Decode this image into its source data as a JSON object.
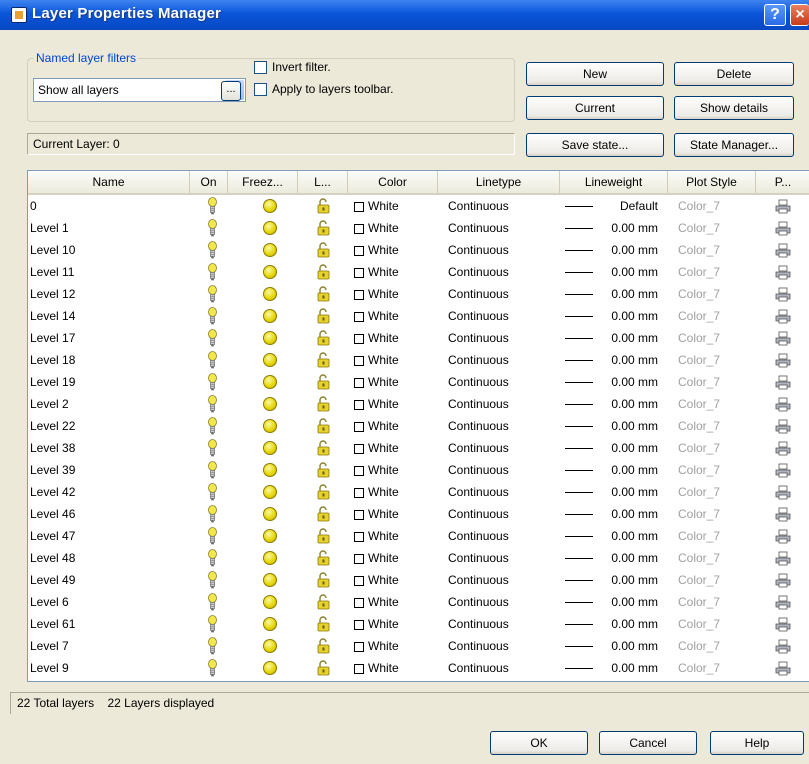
{
  "window": {
    "title": "Layer Properties Manager",
    "help_label": "?",
    "close_label": "×",
    "app_icon": "layer-properties-icon"
  },
  "filters": {
    "group_label": "Named layer filters",
    "selected": "Show all layers",
    "ellipsis_label": "...",
    "invert_label": "Invert filter.",
    "invert_checked": false,
    "apply_label": "Apply to layers toolbar.",
    "apply_checked": false
  },
  "buttons": {
    "new": "New",
    "delete": "Delete",
    "current": "Current",
    "show_details": "Show details",
    "save_state": "Save state...",
    "state_manager": "State Manager...",
    "ok": "OK",
    "cancel": "Cancel",
    "help": "Help"
  },
  "current_layer": "Current Layer: 0",
  "columns": [
    "Name",
    "On",
    "Freez...",
    "L...",
    "Color",
    "Linetype",
    "Lineweight",
    "Plot Style",
    "P..."
  ],
  "layers": [
    {
      "name": "0",
      "on": true,
      "frozen": false,
      "locked": false,
      "color": "White",
      "linetype": "Continuous",
      "lineweight": "Default",
      "plot_style": "Color_7"
    },
    {
      "name": "Level 1",
      "on": true,
      "frozen": false,
      "locked": false,
      "color": "White",
      "linetype": "Continuous",
      "lineweight": "0.00 mm",
      "plot_style": "Color_7"
    },
    {
      "name": "Level 10",
      "on": true,
      "frozen": false,
      "locked": false,
      "color": "White",
      "linetype": "Continuous",
      "lineweight": "0.00 mm",
      "plot_style": "Color_7"
    },
    {
      "name": "Level 11",
      "on": true,
      "frozen": false,
      "locked": false,
      "color": "White",
      "linetype": "Continuous",
      "lineweight": "0.00 mm",
      "plot_style": "Color_7"
    },
    {
      "name": "Level 12",
      "on": true,
      "frozen": false,
      "locked": false,
      "color": "White",
      "linetype": "Continuous",
      "lineweight": "0.00 mm",
      "plot_style": "Color_7"
    },
    {
      "name": "Level 14",
      "on": true,
      "frozen": false,
      "locked": false,
      "color": "White",
      "linetype": "Continuous",
      "lineweight": "0.00 mm",
      "plot_style": "Color_7"
    },
    {
      "name": "Level 17",
      "on": true,
      "frozen": false,
      "locked": false,
      "color": "White",
      "linetype": "Continuous",
      "lineweight": "0.00 mm",
      "plot_style": "Color_7"
    },
    {
      "name": "Level 18",
      "on": true,
      "frozen": false,
      "locked": false,
      "color": "White",
      "linetype": "Continuous",
      "lineweight": "0.00 mm",
      "plot_style": "Color_7"
    },
    {
      "name": "Level 19",
      "on": true,
      "frozen": false,
      "locked": false,
      "color": "White",
      "linetype": "Continuous",
      "lineweight": "0.00 mm",
      "plot_style": "Color_7"
    },
    {
      "name": "Level 2",
      "on": true,
      "frozen": false,
      "locked": false,
      "color": "White",
      "linetype": "Continuous",
      "lineweight": "0.00 mm",
      "plot_style": "Color_7"
    },
    {
      "name": "Level 22",
      "on": true,
      "frozen": false,
      "locked": false,
      "color": "White",
      "linetype": "Continuous",
      "lineweight": "0.00 mm",
      "plot_style": "Color_7"
    },
    {
      "name": "Level 38",
      "on": true,
      "frozen": false,
      "locked": false,
      "color": "White",
      "linetype": "Continuous",
      "lineweight": "0.00 mm",
      "plot_style": "Color_7"
    },
    {
      "name": "Level 39",
      "on": true,
      "frozen": false,
      "locked": false,
      "color": "White",
      "linetype": "Continuous",
      "lineweight": "0.00 mm",
      "plot_style": "Color_7"
    },
    {
      "name": "Level 42",
      "on": true,
      "frozen": false,
      "locked": false,
      "color": "White",
      "linetype": "Continuous",
      "lineweight": "0.00 mm",
      "plot_style": "Color_7"
    },
    {
      "name": "Level 46",
      "on": true,
      "frozen": false,
      "locked": false,
      "color": "White",
      "linetype": "Continuous",
      "lineweight": "0.00 mm",
      "plot_style": "Color_7"
    },
    {
      "name": "Level 47",
      "on": true,
      "frozen": false,
      "locked": false,
      "color": "White",
      "linetype": "Continuous",
      "lineweight": "0.00 mm",
      "plot_style": "Color_7"
    },
    {
      "name": "Level 48",
      "on": true,
      "frozen": false,
      "locked": false,
      "color": "White",
      "linetype": "Continuous",
      "lineweight": "0.00 mm",
      "plot_style": "Color_7"
    },
    {
      "name": "Level 49",
      "on": true,
      "frozen": false,
      "locked": false,
      "color": "White",
      "linetype": "Continuous",
      "lineweight": "0.00 mm",
      "plot_style": "Color_7"
    },
    {
      "name": "Level 6",
      "on": true,
      "frozen": false,
      "locked": false,
      "color": "White",
      "linetype": "Continuous",
      "lineweight": "0.00 mm",
      "plot_style": "Color_7"
    },
    {
      "name": "Level 61",
      "on": true,
      "frozen": false,
      "locked": false,
      "color": "White",
      "linetype": "Continuous",
      "lineweight": "0.00 mm",
      "plot_style": "Color_7"
    },
    {
      "name": "Level 7",
      "on": true,
      "frozen": false,
      "locked": false,
      "color": "White",
      "linetype": "Continuous",
      "lineweight": "0.00 mm",
      "plot_style": "Color_7"
    },
    {
      "name": "Level 9",
      "on": true,
      "frozen": false,
      "locked": false,
      "color": "White",
      "linetype": "Continuous",
      "lineweight": "0.00 mm",
      "plot_style": "Color_7"
    }
  ],
  "row_icons": {
    "on": "lightbulb-icon",
    "freeze": "sun-icon",
    "lock": "padlock-open-icon",
    "plot": "printer-icon"
  },
  "status": {
    "total": "22 Total layers",
    "displayed": "22 Layers displayed"
  },
  "colors": {
    "titlebar": "#0a55d9",
    "accent_text": "#0046d5",
    "plot_style_text": "#a0a0a0",
    "bulb": "#f2e84a",
    "sun": "#e4d400"
  }
}
